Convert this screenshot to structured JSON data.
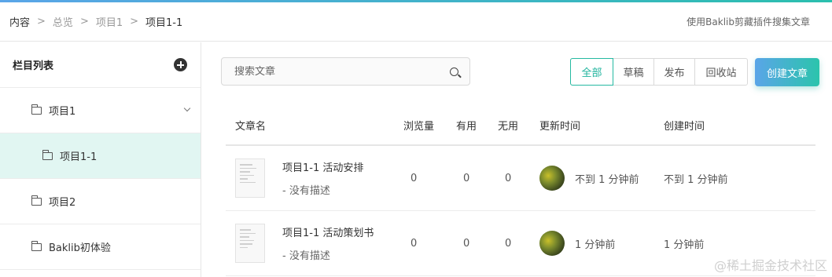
{
  "breadcrumb": [
    "内容",
    "总览",
    "项目1",
    "项目1-1"
  ],
  "breadcrumb_sep": ">",
  "header_link": "使用Baklib剪藏插件搜集文章",
  "sidebar": {
    "title": "栏目列表",
    "items": [
      {
        "label": "项目1"
      },
      {
        "label": "项目1-1"
      },
      {
        "label": "项目2"
      },
      {
        "label": "Baklib初体验"
      }
    ]
  },
  "search": {
    "placeholder": "搜索文章"
  },
  "filters": [
    "全部",
    "草稿",
    "发布",
    "回收站"
  ],
  "create_button": "创建文章",
  "table": {
    "headers": [
      "文章名",
      "浏览量",
      "有用",
      "无用",
      "更新时间",
      "创建时间"
    ],
    "rows": [
      {
        "title": "项目1-1 活动安排",
        "desc": "- 没有描述",
        "views": "0",
        "useful": "0",
        "useless": "0",
        "updated": "不到 1 分钟前",
        "created": "不到 1 分钟前"
      },
      {
        "title": "项目1-1 活动策划书",
        "desc": "- 没有描述",
        "views": "0",
        "useful": "0",
        "useless": "0",
        "updated": "1 分钟前",
        "created": "1 分钟前"
      }
    ]
  },
  "watermark": "@稀土掘金技术社区",
  "colors": {
    "accent": "#25b9a1",
    "active_bg": "#e1f6f2",
    "brand_gradient_start": "#5aa5e8",
    "brand_gradient_end": "#2bc4ac"
  }
}
